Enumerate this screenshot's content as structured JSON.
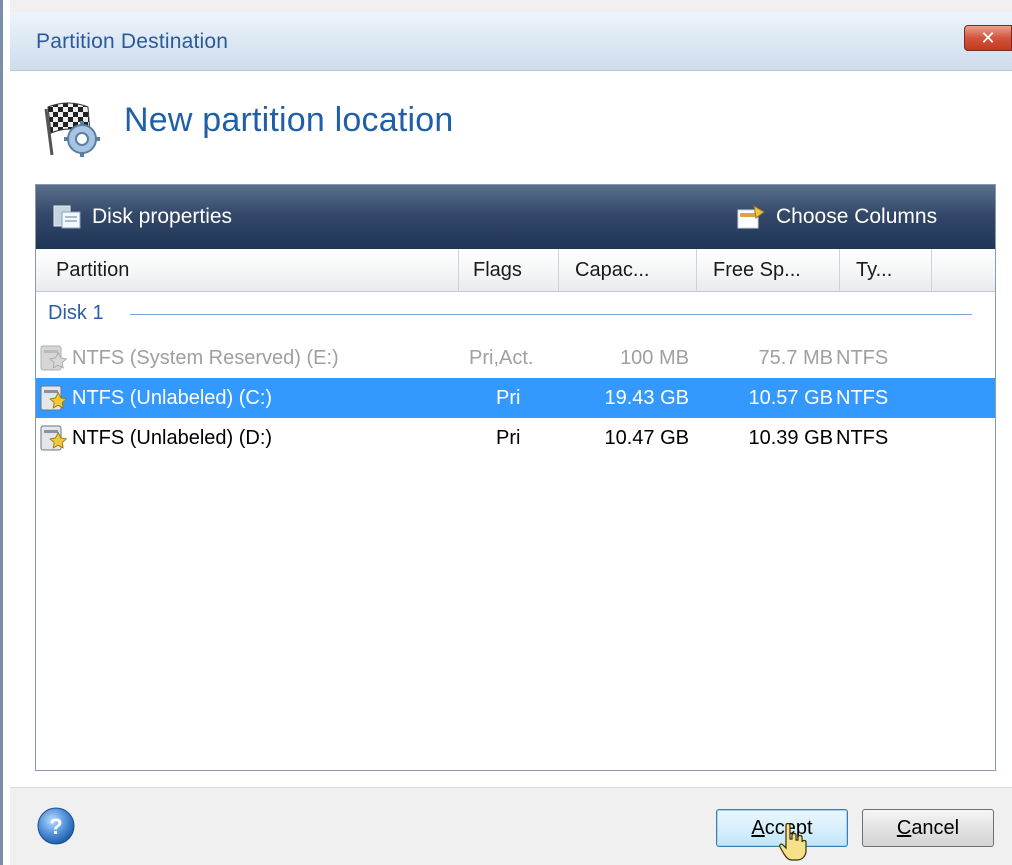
{
  "window": {
    "title": "Partition Destination",
    "close_label": "x"
  },
  "header": {
    "title": "New partition location",
    "icon": "checkered-flag-gear-icon"
  },
  "toolbar": {
    "disk_properties_label": "Disk properties",
    "choose_columns_label": "Choose Columns"
  },
  "table": {
    "columns": [
      "Partition",
      "Flags",
      "Capac...",
      "Free Sp...",
      "Ty..."
    ],
    "group_label": "Disk 1",
    "rows": [
      {
        "partition": "NTFS (System Reserved) (E:)",
        "flags": "Pri,Act.",
        "capacity": "100 MB",
        "free": "75.7 MB",
        "type": "NTFS",
        "state": "disabled"
      },
      {
        "partition": "NTFS (Unlabeled) (C:)",
        "flags": "Pri",
        "capacity": "19.43 GB",
        "free": "10.57 GB",
        "type": "NTFS",
        "state": "selected"
      },
      {
        "partition": "NTFS (Unlabeled) (D:)",
        "flags": "Pri",
        "capacity": "10.47 GB",
        "free": "10.39 GB",
        "type": "NTFS",
        "state": "normal"
      }
    ]
  },
  "footer": {
    "accept_label_prefix": "A",
    "accept_label_rest": "ccept",
    "cancel_label_prefix": "C",
    "cancel_label_rest": "ancel"
  },
  "colors": {
    "selection": "#3399ff",
    "title_text": "#2a5a99",
    "header_title": "#1f5fa8"
  }
}
